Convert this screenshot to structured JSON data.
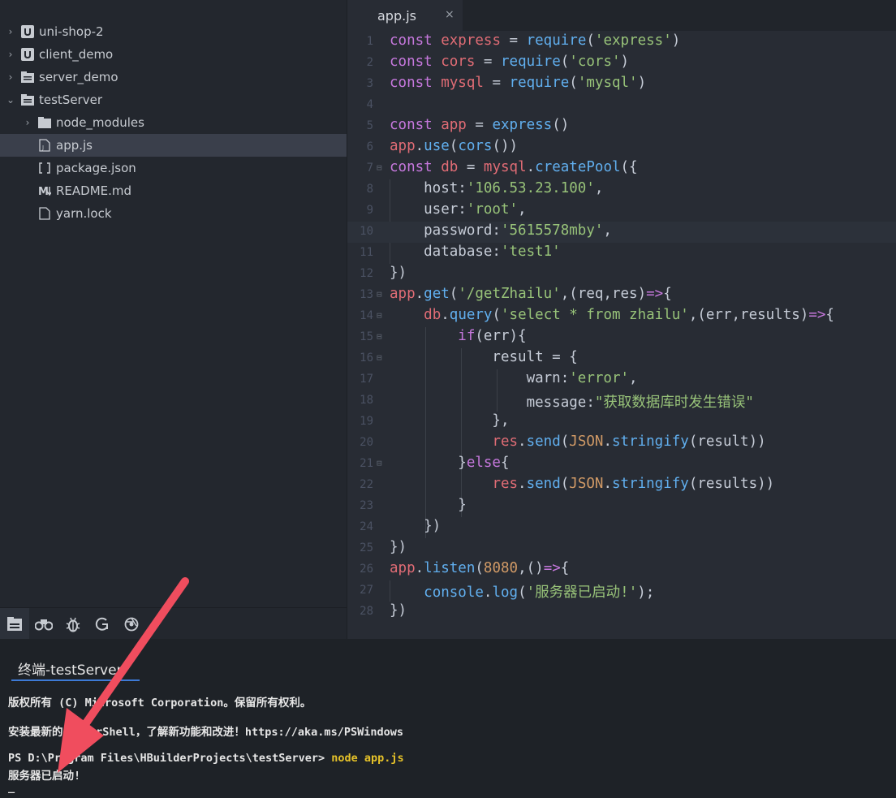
{
  "sidebar": {
    "items": [
      {
        "label": "uni-shop-2",
        "icon": "uni-project-icon"
      },
      {
        "label": "client_demo",
        "icon": "uni-project-icon"
      },
      {
        "label": "server_demo",
        "icon": "folder-project-icon"
      },
      {
        "label": "testServer",
        "icon": "folder-project-icon"
      },
      {
        "label": "node_modules",
        "icon": "folder-icon"
      },
      {
        "label": "app.js",
        "icon": "js-file-icon"
      },
      {
        "label": "package.json",
        "icon": "json-file-icon"
      },
      {
        "label": "README.md",
        "icon": "markdown-icon"
      },
      {
        "label": "yarn.lock",
        "icon": "file-icon"
      }
    ],
    "selected": "app.js",
    "tools": [
      "project-manager-icon",
      "search-binoculars-icon",
      "debug-bug-icon",
      "git-icon",
      "browser-icon"
    ]
  },
  "editor": {
    "tab": {
      "label": "app.js",
      "close": "×"
    },
    "line_numbers": [
      "1",
      "2",
      "3",
      "4",
      "5",
      "6",
      "7",
      "8",
      "9",
      "10",
      "11",
      "12",
      "13",
      "14",
      "15",
      "16",
      "17",
      "18",
      "19",
      "20",
      "21",
      "22",
      "23",
      "24",
      "25",
      "26",
      "27",
      "28"
    ],
    "lines": [
      [
        [
          "kw",
          "const"
        ],
        [
          "pn",
          " "
        ],
        [
          "vr",
          "express"
        ],
        [
          "pn",
          " = "
        ],
        [
          "fn",
          "require"
        ],
        [
          "pn",
          "("
        ],
        [
          "st",
          "'express'"
        ],
        [
          "pn",
          ")"
        ]
      ],
      [
        [
          "kw",
          "const"
        ],
        [
          "pn",
          " "
        ],
        [
          "vr",
          "cors"
        ],
        [
          "pn",
          " = "
        ],
        [
          "fn",
          "require"
        ],
        [
          "pn",
          "("
        ],
        [
          "st",
          "'cors'"
        ],
        [
          "pn",
          ")"
        ]
      ],
      [
        [
          "kw",
          "const"
        ],
        [
          "pn",
          " "
        ],
        [
          "vr",
          "mysql"
        ],
        [
          "pn",
          " = "
        ],
        [
          "fn",
          "require"
        ],
        [
          "pn",
          "("
        ],
        [
          "st",
          "'mysql'"
        ],
        [
          "pn",
          ")"
        ]
      ],
      [],
      [
        [
          "kw",
          "const"
        ],
        [
          "pn",
          " "
        ],
        [
          "vr",
          "app"
        ],
        [
          "pn",
          " = "
        ],
        [
          "fn",
          "express"
        ],
        [
          "pn",
          "()"
        ]
      ],
      [
        [
          "vr",
          "app"
        ],
        [
          "pn",
          "."
        ],
        [
          "fn",
          "use"
        ],
        [
          "pn",
          "("
        ],
        [
          "fn",
          "cors"
        ],
        [
          "pn",
          "())"
        ]
      ],
      [
        [
          "kw",
          "const"
        ],
        [
          "pn",
          " "
        ],
        [
          "vr",
          "db"
        ],
        [
          "pn",
          " = "
        ],
        [
          "vr",
          "mysql"
        ],
        [
          "pn",
          "."
        ],
        [
          "fn",
          "createPool"
        ],
        [
          "pn",
          "({"
        ]
      ],
      [
        [
          "pn",
          "    host:"
        ],
        [
          "st",
          "'106.53.23.100'"
        ],
        [
          "pn",
          ","
        ]
      ],
      [
        [
          "pn",
          "    user:"
        ],
        [
          "st",
          "'root'"
        ],
        [
          "pn",
          ","
        ]
      ],
      [
        [
          "pn",
          "    password:"
        ],
        [
          "st",
          "'5615578mby'"
        ],
        [
          "pn",
          ","
        ]
      ],
      [
        [
          "pn",
          "    database:"
        ],
        [
          "st",
          "'test1'"
        ]
      ],
      [
        [
          "pn",
          "})"
        ]
      ],
      [
        [
          "vr",
          "app"
        ],
        [
          "pn",
          "."
        ],
        [
          "fn",
          "get"
        ],
        [
          "pn",
          "("
        ],
        [
          "st",
          "'/getZhailu'"
        ],
        [
          "pn",
          ",(req,res)"
        ],
        [
          "kw",
          "=>"
        ],
        [
          "pn",
          "{"
        ]
      ],
      [
        [
          "pn",
          "    "
        ],
        [
          "vr",
          "db"
        ],
        [
          "pn",
          "."
        ],
        [
          "fn",
          "query"
        ],
        [
          "pn",
          "("
        ],
        [
          "st",
          "'select * from zhailu'"
        ],
        [
          "pn",
          ",(err,results)"
        ],
        [
          "kw",
          "=>"
        ],
        [
          "pn",
          "{"
        ]
      ],
      [
        [
          "pn",
          "        "
        ],
        [
          "kw",
          "if"
        ],
        [
          "pn",
          "(err){"
        ]
      ],
      [
        [
          "pn",
          "            result = {"
        ]
      ],
      [
        [
          "pn",
          "                warn:"
        ],
        [
          "st",
          "'error'"
        ],
        [
          "pn",
          ","
        ]
      ],
      [
        [
          "pn",
          "                message:"
        ],
        [
          "st",
          "\"获取数据库时发生错误\""
        ]
      ],
      [
        [
          "pn",
          "            },"
        ]
      ],
      [
        [
          "pn",
          "            "
        ],
        [
          "vr",
          "res"
        ],
        [
          "pn",
          "."
        ],
        [
          "fn",
          "send"
        ],
        [
          "pn",
          "("
        ],
        [
          "nm",
          "JSON"
        ],
        [
          "pn",
          "."
        ],
        [
          "fn",
          "stringify"
        ],
        [
          "pn",
          "(result))"
        ]
      ],
      [
        [
          "pn",
          "        }"
        ],
        [
          "kw",
          "else"
        ],
        [
          "pn",
          "{"
        ]
      ],
      [
        [
          "pn",
          "            "
        ],
        [
          "vr",
          "res"
        ],
        [
          "pn",
          "."
        ],
        [
          "fn",
          "send"
        ],
        [
          "pn",
          "("
        ],
        [
          "nm",
          "JSON"
        ],
        [
          "pn",
          "."
        ],
        [
          "fn",
          "stringify"
        ],
        [
          "pn",
          "(results))"
        ]
      ],
      [
        [
          "pn",
          "        }"
        ]
      ],
      [
        [
          "pn",
          "    })"
        ]
      ],
      [
        [
          "pn",
          "})"
        ]
      ],
      [
        [
          "vr",
          "app"
        ],
        [
          "pn",
          "."
        ],
        [
          "fn",
          "listen"
        ],
        [
          "pn",
          "("
        ],
        [
          "nm",
          "8080"
        ],
        [
          "pn",
          ",()"
        ],
        [
          "kw",
          "=>"
        ],
        [
          "pn",
          "{"
        ]
      ],
      [
        [
          "pn",
          "    "
        ],
        [
          "fn",
          "console"
        ],
        [
          "pn",
          "."
        ],
        [
          "fn",
          "log"
        ],
        [
          "pn",
          "("
        ],
        [
          "st",
          "'服务器已启动!'"
        ],
        [
          "pn",
          ");"
        ]
      ],
      [
        [
          "pn",
          "})"
        ]
      ]
    ],
    "fold_lines": [
      7,
      13,
      14,
      15,
      16,
      21
    ],
    "highlight_line": 10
  },
  "terminal": {
    "tab_label": "终端-testServer",
    "lines": [
      "版权所有 (C) Microsoft Corporation。保留所有权利。",
      "",
      "安装最新的 PowerShell，了解新功能和改进！https://aka.ms/PSWindows",
      "",
      "PS D:\\Program Files\\HBuilderProjects\\testServer>",
      "服务器已启动!",
      "_"
    ],
    "command": " node app.js"
  },
  "colors": {
    "annotation_arrow": "#f04d5e",
    "accent": "#3d7ad6"
  }
}
